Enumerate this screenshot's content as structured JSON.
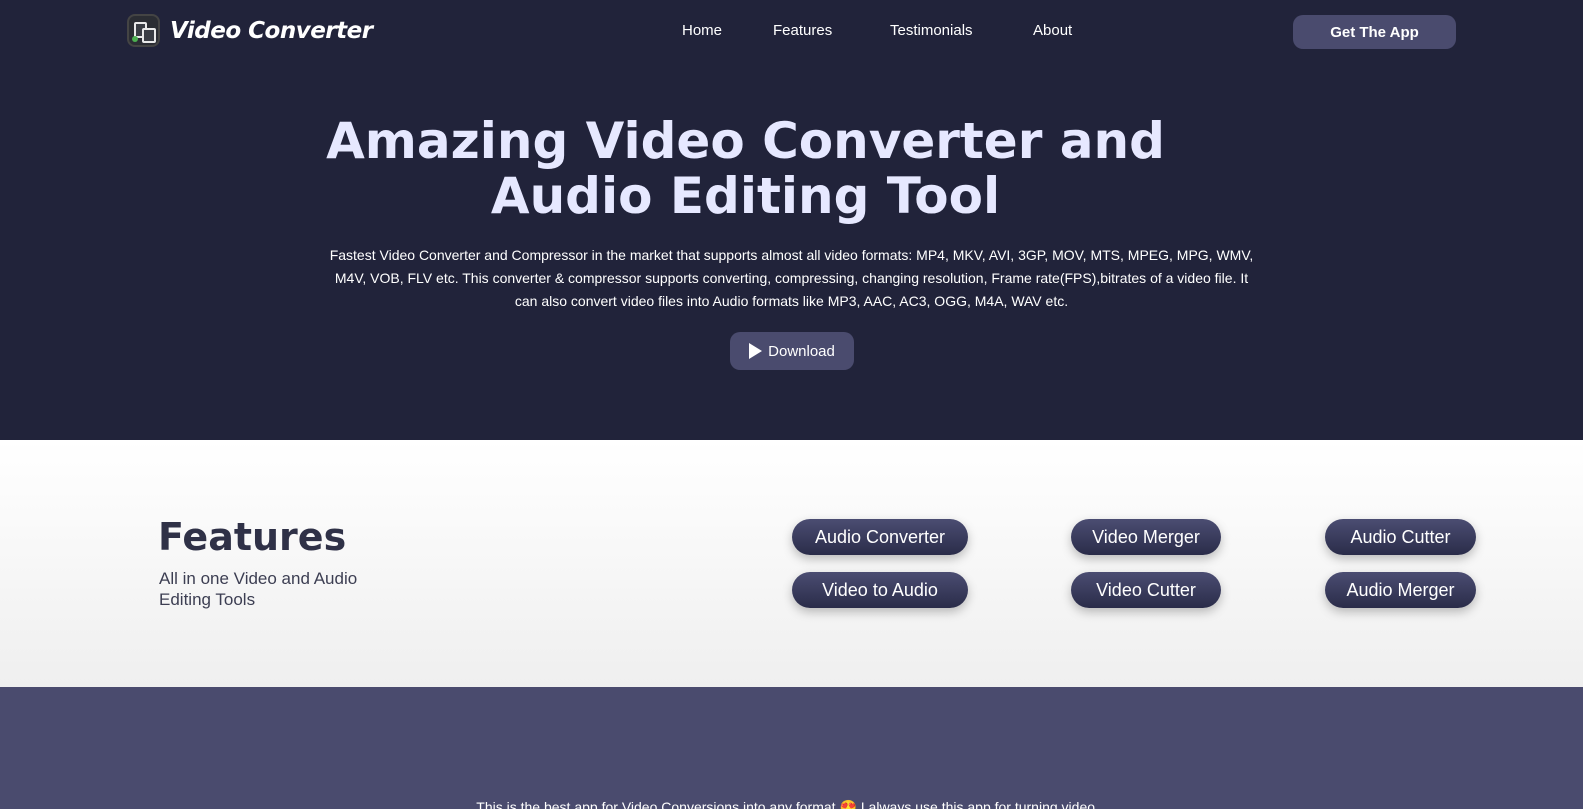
{
  "brand": {
    "name": "Video Converter",
    "logo_icon": "video-converter-logo-icon"
  },
  "nav": {
    "links": [
      "Home",
      "Features",
      "Testimonials",
      "About"
    ],
    "cta": "Get The App"
  },
  "hero": {
    "title_line1": "Amazing Video Converter and",
    "title_line2": "Audio Editing Tool",
    "description": "Fastest Video Converter and Compressor in the market that supports almost all video formats: MP4, MKV, AVI, 3GP, MOV, MTS, MPEG, MPG, WMV, M4V, VOB, FLV etc. This converter & compressor supports converting, compressing, changing resolution, Frame rate(FPS),bitrates of a video file. It can also convert video files into Audio formats like MP3, AAC, AC3, OGG, M4A, WAV etc.",
    "download_label": "Download",
    "download_icon": "play-store-icon"
  },
  "features": {
    "title": "Features",
    "subtitle": "All in one Video and Audio Editing Tools",
    "items": [
      "Audio Converter",
      "Video Merger",
      "Audio Cutter",
      "Video to Audio",
      "Video Cutter",
      "Audio Merger"
    ]
  },
  "testimonial": {
    "text": "This is the best app for Video Conversions into any format 😍 I always use this app for turning video..."
  },
  "colors": {
    "hero_bg": "#21233a",
    "accent": "#4a4b6e",
    "title_color": "#e6e8ff",
    "features_title": "#2f3147"
  }
}
